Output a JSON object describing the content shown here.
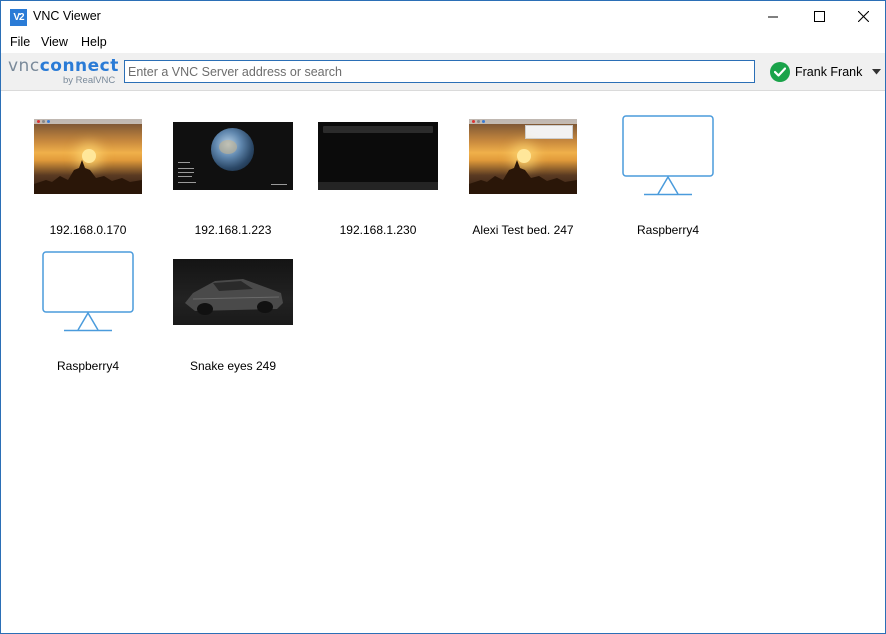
{
  "window": {
    "app_icon_text": "V2",
    "title": "VNC Viewer",
    "controls": [
      "minimize-icon",
      "maximize-icon",
      "close-icon"
    ]
  },
  "menu": {
    "items": [
      "File",
      "View",
      "Help"
    ]
  },
  "toolbar": {
    "logo": {
      "vnc": "vnc",
      "connect": "connect",
      "byline": "by RealVNC"
    },
    "search": {
      "placeholder": "Enter a VNC Server address or search",
      "value": ""
    },
    "user": {
      "name": "Frank Frank",
      "status_icon": "check-circle-icon",
      "status_color": "#1aa34a",
      "menu_icon": "caret-down-icon"
    }
  },
  "connections": [
    {
      "label": "192.168.0.170",
      "thumbnail": "sunset-temple-desktop"
    },
    {
      "label": "192.168.1.223",
      "thumbnail": "earth-desktop"
    },
    {
      "label": "192.168.1.230",
      "thumbnail": "dark-browser-desktop"
    },
    {
      "label": "Alexi Test bed. 247",
      "thumbnail": "sunset-temple-desktop"
    },
    {
      "label": "Raspberry4",
      "thumbnail": "monitor-icon"
    },
    {
      "label": "Raspberry4",
      "thumbnail": "monitor-icon"
    },
    {
      "label": "Snake eyes 249",
      "thumbnail": "car-desktop"
    }
  ],
  "colors": {
    "accent": "#2a7bd6",
    "window_border": "#2b6fb6",
    "toolbar_bg": "#f0f0f0",
    "monitor_stroke": "#4a9bdc"
  }
}
